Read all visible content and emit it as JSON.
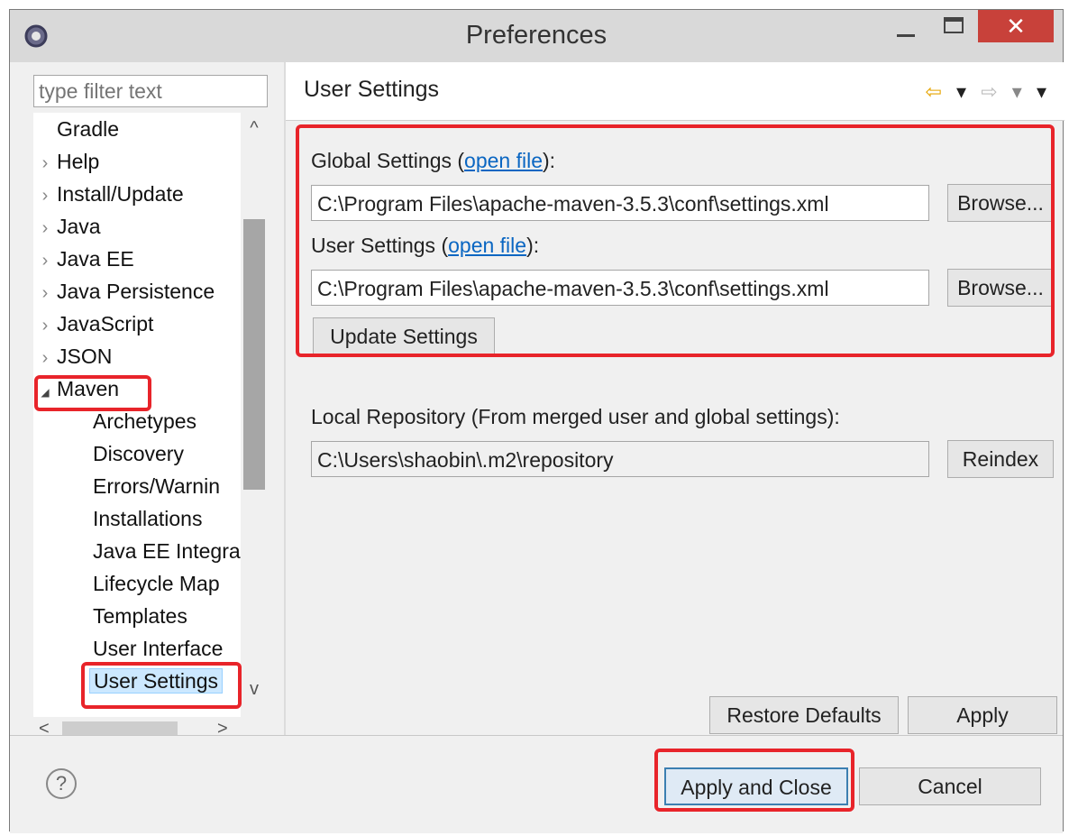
{
  "window": {
    "title": "Preferences",
    "close_symbol": "✕",
    "icons": [
      "eclipse-gear-icon",
      "minimize-icon",
      "maximize-icon",
      "close-icon"
    ]
  },
  "filter": {
    "placeholder": "type filter text"
  },
  "tree": {
    "items": [
      {
        "label": "Gradle",
        "arrow": ""
      },
      {
        "label": "Help",
        "arrow": "›"
      },
      {
        "label": "Install/Update",
        "arrow": "›"
      },
      {
        "label": "Java",
        "arrow": "›"
      },
      {
        "label": "Java EE",
        "arrow": "›"
      },
      {
        "label": "Java Persistence",
        "arrow": "›"
      },
      {
        "label": "JavaScript",
        "arrow": "›"
      },
      {
        "label": "JSON",
        "arrow": "›"
      },
      {
        "label": "Maven",
        "arrow": "◢"
      }
    ],
    "maven_children": [
      "Archetypes",
      "Discovery",
      "Errors/Warnin",
      "Installations",
      "Java EE Integra",
      "Lifecycle Map",
      "Templates",
      "User Interface",
      "User Settings"
    ],
    "selected": "User Settings",
    "scroll_up": "^",
    "scroll_down": "v",
    "scroll_left": "<",
    "scroll_right": ">"
  },
  "page": {
    "title": "User Settings",
    "nav": {
      "back": "⇦",
      "menu1": "▾",
      "forward": "⇨",
      "menu2": "▾",
      "menu3": "▾"
    },
    "global_label_prefix": "Global Settings (",
    "global_link": "open file",
    "global_label_suffix": "):",
    "global_path": "C:\\Program Files\\apache-maven-3.5.3\\conf\\settings.xml",
    "user_label_prefix": "User Settings (",
    "user_link": "open file",
    "user_label_suffix": "):",
    "user_path": "C:\\Program Files\\apache-maven-3.5.3\\conf\\settings.xml",
    "browse1": "Browse...",
    "browse2": "Browse...",
    "update_settings": "Update Settings",
    "local_repo_label": "Local Repository (From merged user and global settings):",
    "local_repo_path": "C:\\Users\\shaobin\\.m2\\repository",
    "reindex": "Reindex",
    "restore_defaults": "Restore Defaults",
    "apply": "Apply"
  },
  "footer": {
    "help": "?",
    "apply_and_close": "Apply and Close",
    "cancel": "Cancel"
  },
  "highlight_color": "#e8242a"
}
